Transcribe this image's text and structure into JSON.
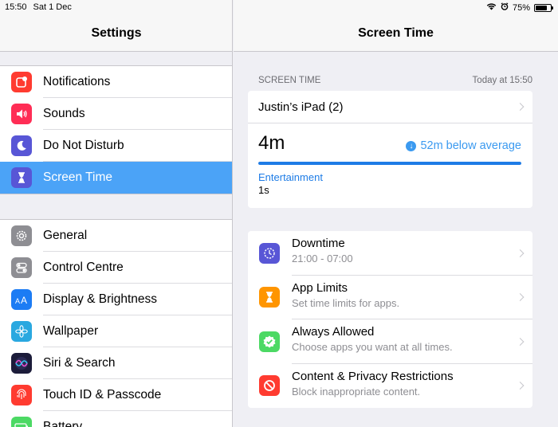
{
  "status": {
    "time": "15:50",
    "date": "Sat 1 Dec",
    "battery": "75%",
    "battery_level": 0.75
  },
  "sidebar": {
    "title": "Settings",
    "group1": [
      {
        "label": "Notifications",
        "icon": "notifications-icon",
        "color": "#ff3b30"
      },
      {
        "label": "Sounds",
        "icon": "speaker-icon",
        "color": "#ff2d55"
      },
      {
        "label": "Do Not Disturb",
        "icon": "moon-icon",
        "color": "#5856d6"
      },
      {
        "label": "Screen Time",
        "icon": "hourglass-icon",
        "color": "#5856d6",
        "selected": true
      }
    ],
    "group2": [
      {
        "label": "General",
        "icon": "gear-icon",
        "color": "#8e8e93"
      },
      {
        "label": "Control Centre",
        "icon": "toggles-icon",
        "color": "#8e8e93"
      },
      {
        "label": "Display & Brightness",
        "icon": "text-size-icon",
        "color": "#1c7cf4"
      },
      {
        "label": "Wallpaper",
        "icon": "flower-icon",
        "color": "#2aa8e0"
      },
      {
        "label": "Siri & Search",
        "icon": "siri-icon",
        "color": "#1c1c3a"
      },
      {
        "label": "Touch ID & Passcode",
        "icon": "fingerprint-icon",
        "color": "#ff3b30"
      },
      {
        "label": "Battery",
        "icon": "battery-icon",
        "color": "#4cd964"
      }
    ]
  },
  "main": {
    "title": "Screen Time",
    "section_label": "SCREEN TIME",
    "section_time": "Today at 15:50",
    "device": "Justin’s iPad (2)",
    "total": "4m",
    "average": "52m below average",
    "usage_fraction": 1.0,
    "category": "Entertainment",
    "category_value": "1s",
    "features": [
      {
        "title": "Downtime",
        "subtitle": "21:00 - 07:00",
        "icon": "downtime-icon",
        "color": "#5856d6"
      },
      {
        "title": "App Limits",
        "subtitle": "Set time limits for apps.",
        "icon": "hourglass-icon",
        "color": "#ff9500"
      },
      {
        "title": "Always Allowed",
        "subtitle": "Choose apps you want at all times.",
        "icon": "checkmark-badge-icon",
        "color": "#4cd964"
      },
      {
        "title": "Content & Privacy Restrictions",
        "subtitle": "Block inappropriate content.",
        "icon": "no-entry-icon",
        "color": "#ff3b30"
      }
    ]
  }
}
